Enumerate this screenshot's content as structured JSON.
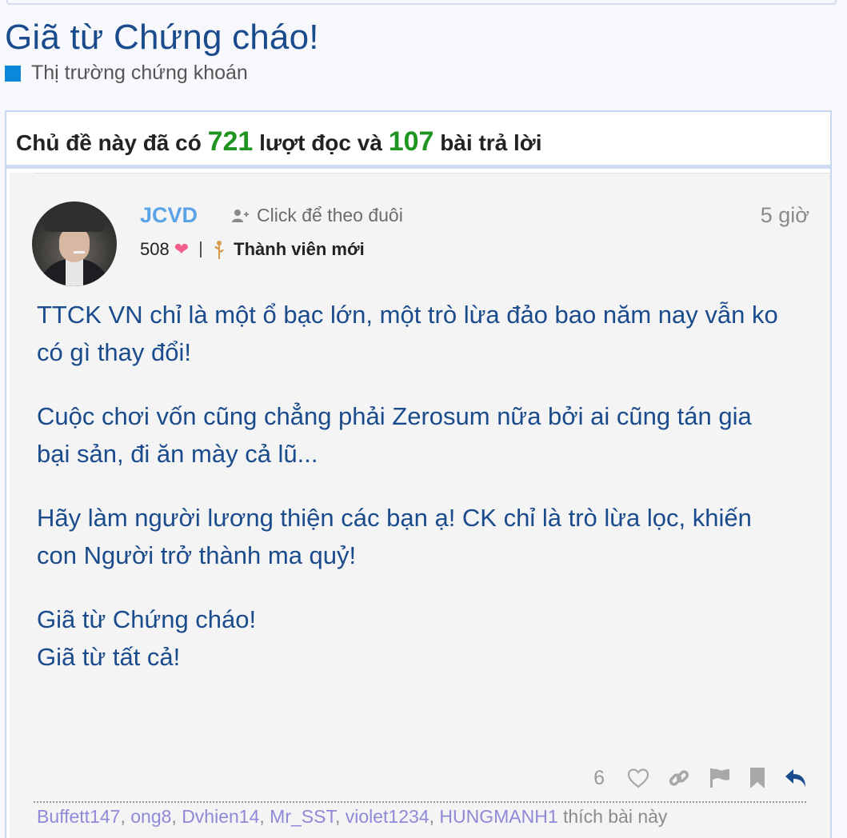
{
  "topic": {
    "title": "Giã từ Chứng cháo!",
    "category": "Thị trường chứng khoán",
    "category_color": "#0b88d9"
  },
  "stats": {
    "prefix": "Chủ đề này đã có",
    "views": "721",
    "views_label": "lượt đọc và",
    "replies": "107",
    "replies_label": "bài trả lời"
  },
  "post": {
    "username": "JCVD",
    "follow_label": "Click để theo đuôi",
    "time": "5 giờ",
    "reputation": "508",
    "rank": "Thành viên mới",
    "paragraphs": [
      "TTCK VN chỉ là một ổ bạc lớn, một trò lừa đảo bao năm nay vẫn ko có gì thay đổi!",
      "Cuộc chơi vốn cũng chẳng phải Zerosum nữa bởi ai cũng tán gia bại sản, đi ăn mày cả lũ...",
      "Hãy làm người lương thiện các bạn ạ! CK chỉ là trò lừa lọc, khiến con Người trở thành ma quỷ!"
    ],
    "closing_line_1": "Giã từ Chứng cháo!",
    "closing_line_2": "Giã từ tất cả!",
    "like_count": "6",
    "icons": [
      "heart-outline-icon",
      "link-icon",
      "flag-icon",
      "bookmark-icon",
      "reply-icon"
    ],
    "liked_by": [
      "Buffett147",
      "ong8",
      "Dvhien14",
      "Mr_SST",
      "violet1234",
      "HUNGMANH1"
    ],
    "liked_suffix": "thích bài này"
  },
  "colors": {
    "title": "#1a4b8c",
    "username": "#5aa3e6",
    "stat_number": "#1e9421",
    "heart": "#f0608a",
    "liked_user": "#8e8ad8"
  }
}
